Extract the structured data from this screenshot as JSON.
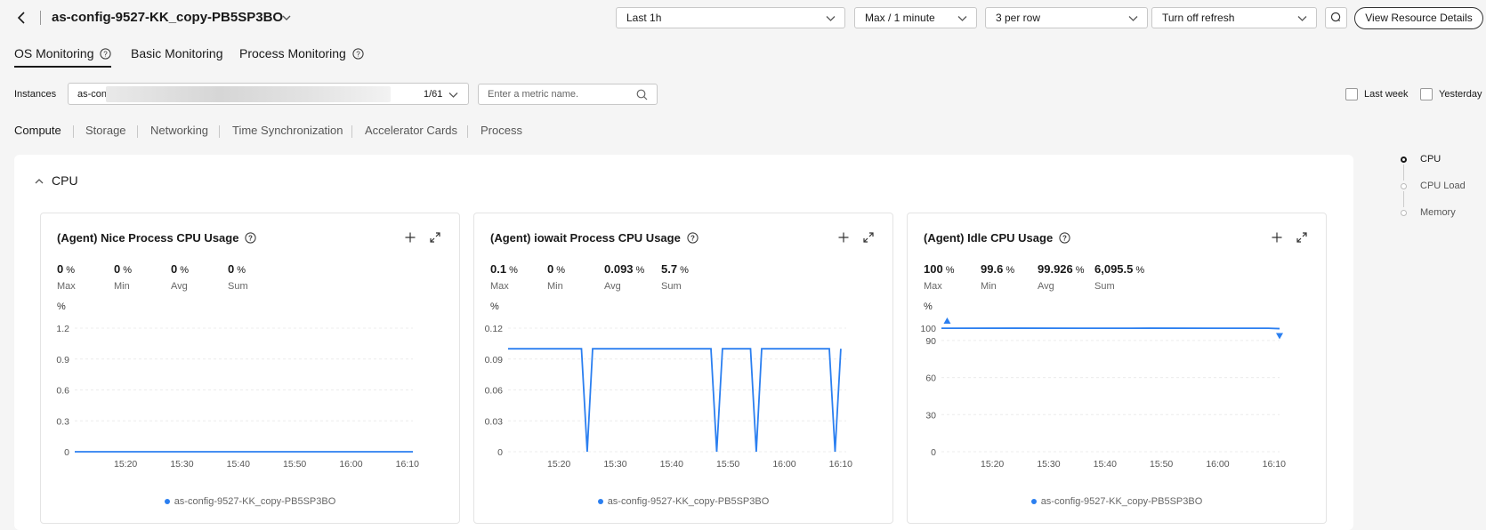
{
  "header": {
    "title": "as-config-9527-KK_copy-PB5SP3BO",
    "time_range": "Last 1h",
    "aggregation": "Max / 1 minute",
    "per_row": "3 per row",
    "refresh": "Turn off refresh",
    "view_details": "View Resource Details"
  },
  "main_tabs": [
    "OS Monitoring",
    "Basic Monitoring",
    "Process Monitoring"
  ],
  "filters": {
    "instances_label": "Instances",
    "instance_value": "as-con",
    "instance_count": "1/61",
    "metric_placeholder": "Enter a metric name.",
    "last_week": "Last week",
    "yesterday": "Yesterday"
  },
  "sub_tabs": [
    "Compute",
    "Storage",
    "Networking",
    "Time Synchronization",
    "Accelerator Cards",
    "Process"
  ],
  "section_title": "CPU",
  "anchor_nav": [
    "CPU",
    "CPU Load",
    "Memory"
  ],
  "stat_labels": [
    "Max",
    "Min",
    "Avg",
    "Sum"
  ],
  "legend_label": "as-config-9527-KK_copy-PB5SP3BO",
  "chart_data": [
    {
      "type": "line",
      "title": "(Agent) Nice Process CPU Usage",
      "ylabel": "%",
      "stats": {
        "max": "0",
        "min": "0",
        "avg": "0",
        "sum": "0",
        "unit": "%"
      },
      "y_ticks": [
        "1.2",
        "0.9",
        "0.6",
        "0.3",
        "0"
      ],
      "ylim": [
        0,
        1.2
      ],
      "x_ticks": [
        "15:20",
        "15:30",
        "15:40",
        "15:50",
        "16:00",
        "16:10"
      ],
      "xlim": [
        15.183,
        16.183
      ],
      "series": [
        {
          "name": "as-config-9527-KK_copy-PB5SP3BO",
          "color": "#2b7ff0",
          "points": [
            [
              15.183,
              0
            ],
            [
              16.183,
              0
            ]
          ]
        }
      ]
    },
    {
      "type": "line",
      "title": "(Agent) iowait Process CPU Usage",
      "ylabel": "%",
      "stats": {
        "max": "0.1",
        "min": "0",
        "avg": "0.093",
        "sum": "5.7",
        "unit": "%"
      },
      "y_ticks": [
        "0.12",
        "0.09",
        "0.06",
        "0.03",
        "0"
      ],
      "ylim": [
        0,
        0.12
      ],
      "x_ticks": [
        "15:20",
        "15:30",
        "15:40",
        "15:50",
        "16:00",
        "16:10"
      ],
      "xlim": [
        15.183,
        16.183
      ],
      "series": [
        {
          "name": "as-config-9527-KK_copy-PB5SP3BO",
          "color": "#2b7ff0",
          "points": [
            [
              15.183,
              0.1
            ],
            [
              15.4,
              0.1
            ],
            [
              15.417,
              0
            ],
            [
              15.433,
              0.1
            ],
            [
              15.783,
              0.1
            ],
            [
              15.8,
              0
            ],
            [
              15.817,
              0.1
            ],
            [
              15.9,
              0.1
            ],
            [
              15.917,
              0
            ],
            [
              15.933,
              0.1
            ],
            [
              16.133,
              0.1
            ],
            [
              16.15,
              0
            ],
            [
              16.167,
              0.1
            ]
          ]
        }
      ]
    },
    {
      "type": "line",
      "title": "(Agent) Idle CPU Usage",
      "ylabel": "%",
      "stats": {
        "max": "100",
        "min": "99.6",
        "avg": "99.926",
        "sum": "6,095.5",
        "unit": "%"
      },
      "y_ticks": [
        "100",
        "90",
        "60",
        "30",
        "0"
      ],
      "ylim": [
        0,
        100
      ],
      "x_ticks": [
        "15:20",
        "15:30",
        "15:40",
        "15:50",
        "16:00",
        "16:10"
      ],
      "xlim": [
        15.183,
        16.183
      ],
      "series": [
        {
          "name": "as-config-9527-KK_copy-PB5SP3BO",
          "color": "#2b7ff0",
          "points": [
            [
              15.183,
              99.9
            ],
            [
              15.4,
              99.95
            ],
            [
              15.6,
              99.9
            ],
            [
              15.8,
              99.95
            ],
            [
              16.0,
              99.9
            ],
            [
              16.15,
              99.9
            ],
            [
              16.183,
              99.6
            ]
          ]
        }
      ],
      "markers": {
        "max": [
          15.2,
          100
        ],
        "min": [
          16.183,
          99.6
        ]
      }
    }
  ]
}
